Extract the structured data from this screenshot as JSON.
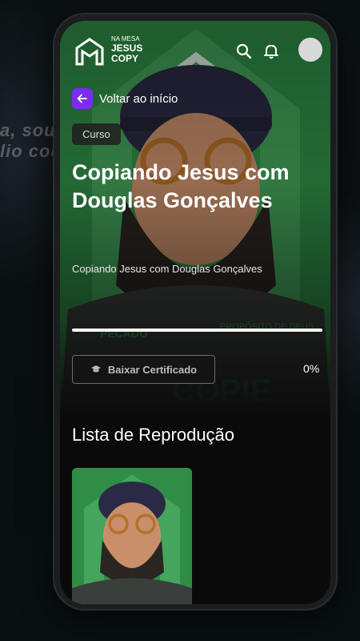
{
  "app": {
    "logo_lines": [
      "NA MESA",
      "JESUS",
      "COPY"
    ]
  },
  "header": {
    "search_icon": "search-icon",
    "bell_icon": "bell-icon"
  },
  "nav": {
    "back_label": "Voltar ao início"
  },
  "course": {
    "badge": "Curso",
    "title": "Copiando Jesus com Douglas Gonçalves",
    "subtitle": "Copiando Jesus com Douglas Gonçalves",
    "progress_percent": 0,
    "progress_label": "0%",
    "certificate_button": "Baixar Certificado"
  },
  "playlist": {
    "title": "Lista de Reprodução"
  },
  "colors": {
    "accent": "#7b2cf0",
    "hero_green": "#2f8d46",
    "background": "#0a0a0a"
  }
}
